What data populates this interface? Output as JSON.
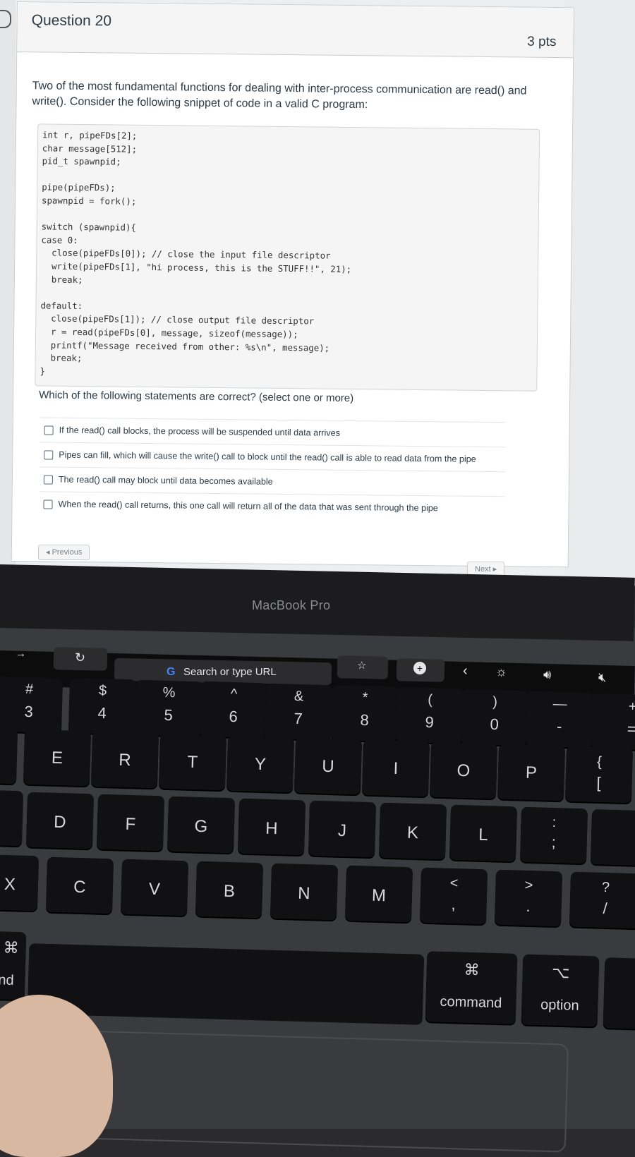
{
  "question": {
    "title": "Question 20",
    "points": "3 pts",
    "intro": "Two of the most fundamental functions for dealing with inter-process communication are read() and write(). Consider the following snippet of code in a valid C program:",
    "code": "int r, pipeFDs[2];\nchar message[512];\npid_t spawnpid;\n\npipe(pipeFDs);\nspawnpid = fork();\n\nswitch (spawnpid){\ncase 0:\n  close(pipeFDs[0]); // close the input file descriptor\n  write(pipeFDs[1], \"hi process, this is the STUFF!!\", 21);\n  break;\n\ndefault:\n  close(pipeFDs[1]); // close output file descriptor\n  r = read(pipeFDs[0], message, sizeof(message));\n  printf(\"Message received from other: %s\\n\", message);\n  break;\n}",
    "prompt": "Which of the following statements are correct? (select one or more)",
    "answers": [
      "If the read() call blocks, the process will be suspended until data arrives",
      "Pipes can fill, which will cause the write() call to block until the read() call is able to read data from the pipe",
      "The read() call may block until data becomes available",
      "When the read() call returns, this one call will return all of the data that was sent through the pipe"
    ]
  },
  "nav": {
    "previous": "◂ Previous",
    "next": "Next ▸"
  },
  "laptop": {
    "brand": "MacBook Pro",
    "touchbar": {
      "search": "Search or type URL",
      "google_letter": "G"
    },
    "keys": {
      "row1": [
        {
          "top": "#",
          "bottom": "3"
        },
        {
          "top": "$",
          "bottom": "4"
        },
        {
          "top": "%",
          "bottom": "5"
        },
        {
          "top": "^",
          "bottom": "6"
        },
        {
          "top": "&",
          "bottom": "7"
        },
        {
          "top": "*",
          "bottom": "8"
        },
        {
          "top": "(",
          "bottom": "9"
        },
        {
          "top": ")",
          "bottom": "0"
        },
        {
          "top": "—",
          "bottom": "-"
        }
      ],
      "row2": [
        "E",
        "R",
        "T",
        "Y",
        "U",
        "I",
        "O",
        "P"
      ],
      "row2_bracket": {
        "top": "{",
        "bottom": "["
      },
      "row3": [
        "D",
        "F",
        "G",
        "H",
        "J",
        "K",
        "L"
      ],
      "row3_colon": {
        "top": ":",
        "bottom": ";"
      },
      "row4": [
        "C",
        "V",
        "B",
        "N",
        "M"
      ],
      "row4_lt": {
        "top": "<",
        "bottom": ","
      },
      "row4_gt": {
        "top": ">",
        "bottom": "."
      },
      "row4_q": {
        "top": "?",
        "bottom": "/"
      },
      "left_x": "X",
      "left_cmd_symbol": "⌘",
      "left_cmd_partial": "nd",
      "command_symbol": "⌘",
      "command_label": "command",
      "option_symbol": "⌥",
      "option_label": "option",
      "plus_top": "+",
      "plus_bottom": "="
    }
  }
}
